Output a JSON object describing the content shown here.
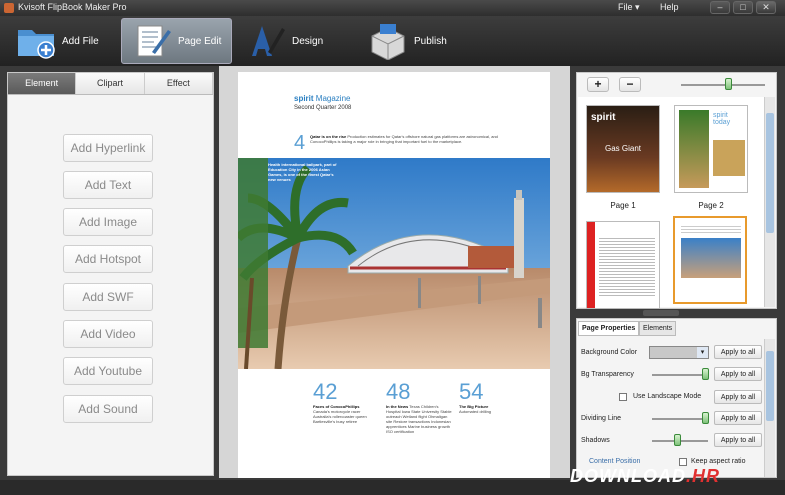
{
  "window": {
    "title": "Kvisoft FlipBook Maker Pro",
    "menu_file": "File ▾",
    "menu_help": "Help",
    "min": "–",
    "restore": "□",
    "close": "✕"
  },
  "toolbar": {
    "add_file": "Add File",
    "page_edit": "Page Edit",
    "design": "Design",
    "publish": "Publish"
  },
  "left_panel": {
    "tabs": [
      "Element",
      "Clipart",
      "Effect"
    ],
    "buttons": [
      "Add Hyperlink",
      "Add Text",
      "Add Image",
      "Add Hotspot",
      "Add SWF",
      "Add Video",
      "Add Youtube",
      "Add Sound"
    ]
  },
  "page": {
    "mag_bold": "spirit",
    "mag_rest": " Magazine",
    "quarter": "Second Quarter 2008",
    "num_top": "4",
    "top_bold": "Qatar is on the rise",
    "top_text": "Production estimates for Qatar's offshore natural gas platforms are astronomical, and ConocoPhillips is taking a major role in bringing that important fuel to the marketplace.",
    "overlay_text": "Health international ballpark, part of Education City in the 2006 Asian Games, is one of the finest Qatar's new venues",
    "stats": [
      {
        "num": "42",
        "bold": "Faces of ConocoPhillips",
        "text": "Canada's motorcycle racer Australia's rollercoaster queen Bartlesville's busy retiree"
      },
      {
        "num": "48",
        "bold": "In the News",
        "text": "Texas Children's Hospital  Iowa State University  Stable outreach  Wetland flight  Ohmaligan site  Restore transactions  Indonesian apprentices  Marine business growth  ISO certification"
      },
      {
        "num": "54",
        "bold": "The Big Picture",
        "text": "Automated drilling"
      }
    ]
  },
  "thumbs": {
    "zoom_in": "+",
    "zoom_out": "−",
    "page1": "Page 1",
    "page2": "Page 2",
    "zoom_level": 0.55
  },
  "props": {
    "tab_page": "Page Properties",
    "tab_elements": "Elements",
    "bg_color_label": "Background Color",
    "bg_color_value": "#c8c8c8",
    "bg_transparency_label": "Bg Transparency",
    "landscape_label": "Use Landscape Mode",
    "dividing_label": "Dividing Line",
    "shadows_label": "Shadows",
    "apply": "Apply to all",
    "content_position": "Content Position",
    "keep_aspect": "Keep aspect ratio"
  },
  "watermark": {
    "a": "DOWNLOAD",
    "b": ".HR"
  },
  "colors": {
    "accent": "#5a9fd4",
    "selected": "#e89a2c"
  }
}
